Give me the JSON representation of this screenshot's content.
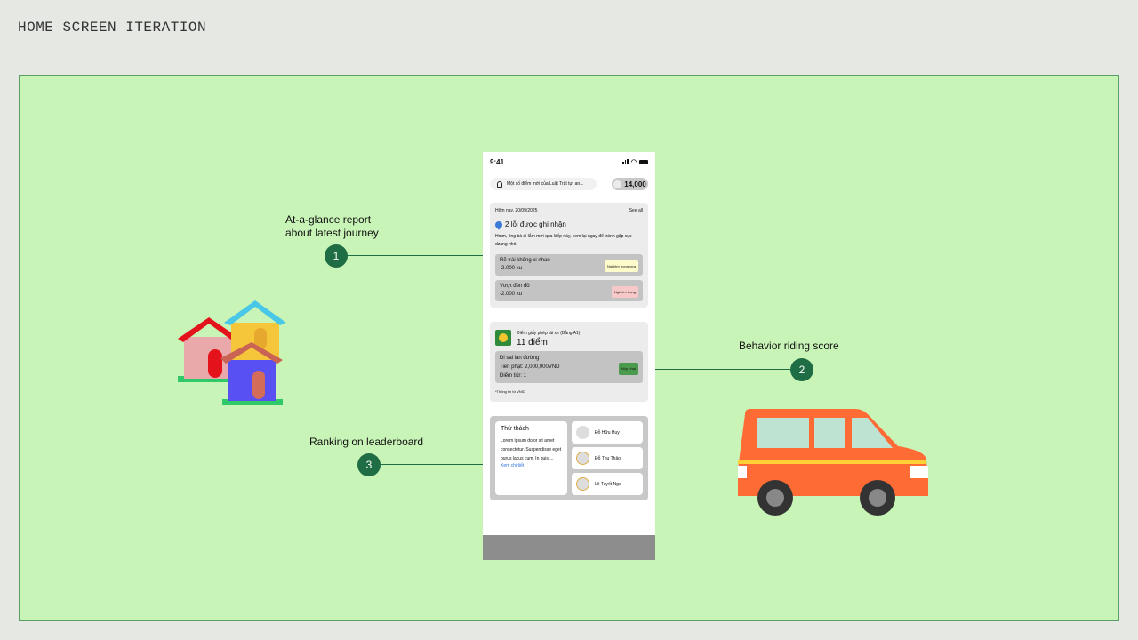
{
  "page": {
    "title": "HOME SCREEN ITERATION"
  },
  "callouts": {
    "c1": {
      "number": "1",
      "line1": "At-a-glance report",
      "line2": "about latest journey"
    },
    "c2": {
      "number": "2",
      "text": "Behavior riding score"
    },
    "c3": {
      "number": "3",
      "text": "Ranking on leaderboard"
    }
  },
  "phone": {
    "status": {
      "time": "9:41"
    },
    "header": {
      "notification": "Một số điểm mới của Luật Trật tự, an...",
      "coins": "14,000"
    },
    "report": {
      "date": "Hôm nay, 20/09/2025",
      "see_all": "See all",
      "title": "2 lỗi được ghi nhận",
      "description": "Hmm, ông bà đi lắm mới qua kiếp này, xem lại ngay để tránh gặp cục dzàng nhó.",
      "violations": [
        {
          "name": "Rẽ trái không xi nhan",
          "points": "-2.000 xu",
          "badge": "Nghiêm trọng vừa"
        },
        {
          "name": "Vượt đèn đỏ",
          "points": "-2.000 xu",
          "badge": "Nghiêm trọng"
        }
      ]
    },
    "license": {
      "label": "Điểm giấy phép lái xe (Bằng A1)",
      "score": "11 điểm",
      "fine_name": "Đi sai làn đường",
      "fine_amount": "Tiền phạt: 2,000,000VND",
      "points_deducted": "Điểm trừ: 1",
      "pay_label": "Nộp phạt",
      "note": "*Thông tin từ VNID"
    },
    "leaderboard": {
      "challenge_title": "Thử thách",
      "challenge_body": "Lorem ipsum dolor sit amet consectetur. Suspendisse eget purus lacus cum. In quis ...",
      "link": "Xem chi tiết",
      "players": [
        "Đỗ Hữu Huy",
        "Đỗ Thu Thảo",
        "Lê Tuyết Nga"
      ]
    }
  },
  "icons": {
    "bell": "bell-icon",
    "coin": "coin-icon",
    "pin": "pin-icon",
    "license": "license-badge-icon",
    "houses": "houses-illustration",
    "van": "van-illustration"
  },
  "colors": {
    "canvas": "#c9f4b7",
    "marker": "#1f6d44",
    "van": "#ff6b35"
  }
}
